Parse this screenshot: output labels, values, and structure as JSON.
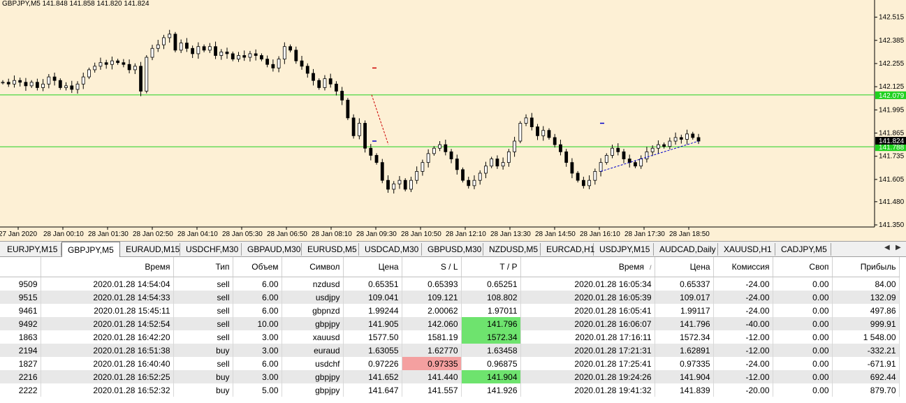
{
  "chart": {
    "title": "GBPJPY,M5  141.848 141.858 141.820 141.824",
    "ymin": 141.35,
    "ymax": 142.58,
    "price_ticks": [
      "142.515",
      "142.385",
      "142.255",
      "142.125",
      "141.995",
      "141.865",
      "141.735",
      "141.605",
      "141.480",
      "141.350"
    ],
    "price_tick_values": [
      142.515,
      142.385,
      142.255,
      142.125,
      141.995,
      141.865,
      141.735,
      141.605,
      141.48,
      141.35
    ],
    "time_labels": [
      "27 Jan 2020",
      "28 Jan 00:10",
      "28 Jan 01:30",
      "28 Jan 02:50",
      "28 Jan 04:10",
      "28 Jan 05:30",
      "28 Jan 06:50",
      "28 Jan 08:10",
      "28 Jan 09:30",
      "28 Jan 10:50",
      "28 Jan 12:10",
      "28 Jan 13:30",
      "28 Jan 14:50",
      "28 Jan 16:10",
      "28 Jan 17:30",
      "28 Jan 18:50"
    ],
    "level_upper": {
      "label": "142.079",
      "value": 142.079,
      "color": "#1fd11f"
    },
    "level_lower": {
      "label": "141.788",
      "value": 141.788,
      "color": "#1fd11f"
    },
    "current": {
      "label": "141.824",
      "value": 141.824
    },
    "closes": [
      142.15,
      142.14,
      142.16,
      142.15,
      142.13,
      142.15,
      142.12,
      142.14,
      142.18,
      142.16,
      142.12,
      142.13,
      142.11,
      142.14,
      142.18,
      142.22,
      142.24,
      142.26,
      142.25,
      142.27,
      142.26,
      142.25,
      142.22,
      142.24,
      142.1,
      142.29,
      142.34,
      142.36,
      142.4,
      142.42,
      142.33,
      142.37,
      142.34,
      142.31,
      142.35,
      142.33,
      142.35,
      142.3,
      142.32,
      142.31,
      142.28,
      142.3,
      142.29,
      142.31,
      142.3,
      142.28,
      142.25,
      142.23,
      142.28,
      142.35,
      142.33,
      142.27,
      142.24,
      142.2,
      142.16,
      142.12,
      142.17,
      142.14,
      142.1,
      142.05,
      141.95,
      141.85,
      141.92,
      141.78,
      141.74,
      141.7,
      141.6,
      141.55,
      141.58,
      141.6,
      141.55,
      141.6,
      141.65,
      141.7,
      141.75,
      141.78,
      141.8,
      141.76,
      141.72,
      141.66,
      141.6,
      141.57,
      141.6,
      141.64,
      141.68,
      141.72,
      141.68,
      141.7,
      141.76,
      141.82,
      141.92,
      141.95,
      141.9,
      141.85,
      141.88,
      141.84,
      141.8,
      141.76,
      141.7,
      141.64,
      141.6,
      141.57,
      141.6,
      141.65,
      141.7,
      141.74,
      141.78,
      141.76,
      141.72,
      141.7,
      141.68,
      141.72,
      141.76,
      141.78,
      141.8,
      141.79,
      141.82,
      141.84,
      141.83,
      141.86,
      141.84,
      141.82
    ],
    "markers": [
      {
        "price": 142.23,
        "color": "#cc0000"
      },
      {
        "price": 141.82,
        "color": "#0000cc"
      },
      {
        "price": 141.92,
        "color": "#0000cc"
      }
    ]
  },
  "tabs": [
    "EURJPY,M15",
    "GBPJPY,M5",
    "EURAUD,M15",
    "USDCHF,M30",
    "GBPAUD,M30",
    "EURUSD,M5",
    "USDCAD,M30",
    "GBPUSD,M30",
    "NZDUSD,M5",
    "EURCAD,H1",
    "USDJPY,M15",
    "AUDCAD,Daily",
    "XAUUSD,H1",
    "CADJPY,M5"
  ],
  "active_tab": 1,
  "table": {
    "headers": [
      "",
      "Время",
      "Тип",
      "Объем",
      "Символ",
      "Цена",
      "S / L",
      "T / P",
      "Время",
      "Цена",
      "Комиссия",
      "Своп",
      "Прибыль"
    ],
    "sort_mark": "/",
    "rows": [
      {
        "cells": [
          "9509",
          "2020.01.28 14:54:04",
          "sell",
          "6.00",
          "nzdusd",
          "0.65351",
          "0.65393",
          "0.65251",
          "2020.01.28 16:05:34",
          "0.65337",
          "-24.00",
          "0.00",
          "84.00"
        ],
        "hl": {}
      },
      {
        "cells": [
          "9515",
          "2020.01.28 14:54:33",
          "sell",
          "6.00",
          "usdjpy",
          "109.041",
          "109.121",
          "108.802",
          "2020.01.28 16:05:39",
          "109.017",
          "-24.00",
          "0.00",
          "132.09"
        ],
        "hl": {}
      },
      {
        "cells": [
          "9461",
          "2020.01.28 15:45:11",
          "sell",
          "6.00",
          "gbpnzd",
          "1.99244",
          "2.00062",
          "1.97011",
          "2020.01.28 16:05:41",
          "1.99117",
          "-24.00",
          "0.00",
          "497.86"
        ],
        "hl": {}
      },
      {
        "cells": [
          "9492",
          "2020.01.28 14:52:54",
          "sell",
          "10.00",
          "gbpjpy",
          "141.905",
          "142.060",
          "141.796",
          "2020.01.28 16:06:07",
          "141.796",
          "-40.00",
          "0.00",
          "999.91"
        ],
        "hl": {
          "7": "green"
        }
      },
      {
        "cells": [
          "1863",
          "2020.01.28 16:42:20",
          "sell",
          "3.00",
          "xauusd",
          "1577.50",
          "1581.19",
          "1572.34",
          "2020.01.28 17:16:11",
          "1572.34",
          "-12.00",
          "0.00",
          "1 548.00"
        ],
        "hl": {
          "7": "green"
        }
      },
      {
        "cells": [
          "2194",
          "2020.01.28 16:51:38",
          "buy",
          "3.00",
          "euraud",
          "1.63055",
          "1.62770",
          "1.63458",
          "2020.01.28 17:21:31",
          "1.62891",
          "-12.00",
          "0.00",
          "-332.21"
        ],
        "hl": {}
      },
      {
        "cells": [
          "1827",
          "2020.01.28 16:40:40",
          "sell",
          "6.00",
          "usdchf",
          "0.97226",
          "0.97335",
          "0.96875",
          "2020.01.28 17:25:41",
          "0.97335",
          "-24.00",
          "0.00",
          "-671.91"
        ],
        "hl": {
          "6": "red"
        }
      },
      {
        "cells": [
          "2216",
          "2020.01.28 16:52:25",
          "buy",
          "3.00",
          "gbpjpy",
          "141.652",
          "141.440",
          "141.904",
          "2020.01.28 19:24:26",
          "141.904",
          "-12.00",
          "0.00",
          "692.44"
        ],
        "hl": {
          "7": "green"
        }
      },
      {
        "cells": [
          "2222",
          "2020.01.28 16:52:32",
          "buy",
          "5.00",
          "gbpjpy",
          "141.647",
          "141.557",
          "141.926",
          "2020.01.28 19:41:32",
          "141.839",
          "-20.00",
          "0.00",
          "879.70"
        ],
        "hl": {}
      }
    ]
  }
}
